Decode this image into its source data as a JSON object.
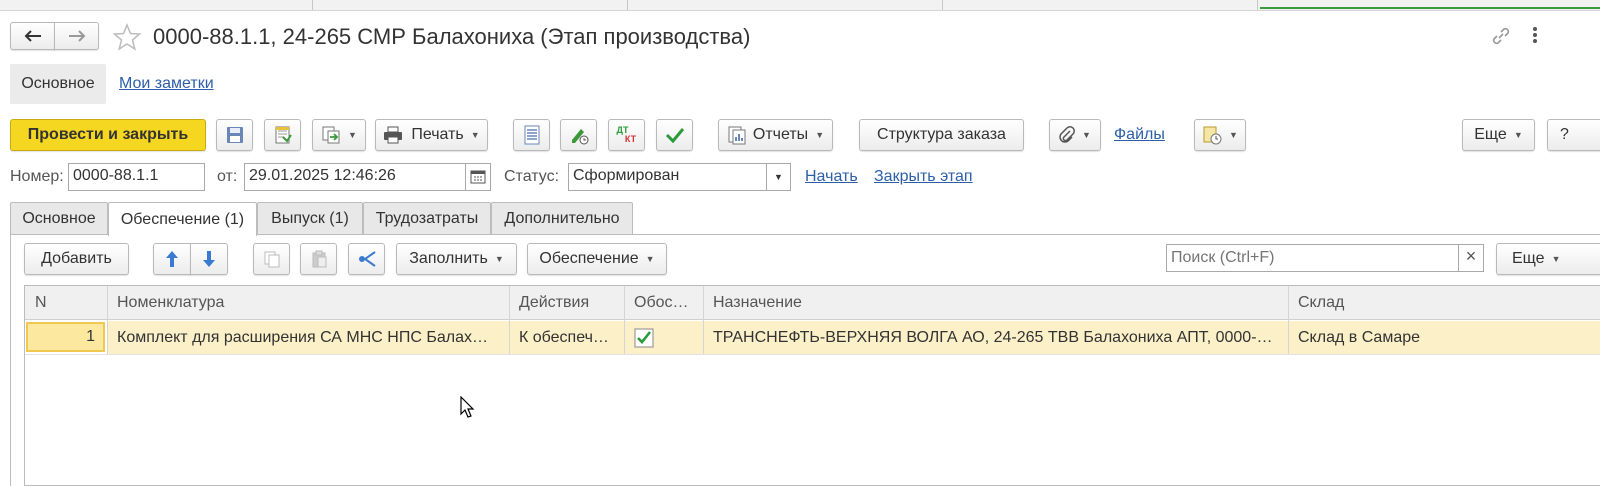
{
  "window": {
    "title": "0000-88.1.1, 24-265 СМР Балахониха (Этап производства)"
  },
  "nav_tabs": [
    {
      "label": "Основное"
    },
    {
      "label": "Мои заметки"
    }
  ],
  "toolbar": {
    "post_close_label": "Провести и закрыть",
    "print_label": "Печать",
    "reports_label": "Отчеты",
    "structure_label": "Структура заказа",
    "files_label": "Файлы",
    "more_label": "Еще",
    "help_label": "?",
    "dtkt_top": "ДТ",
    "dtkt_bottom": "КТ"
  },
  "header_fields": {
    "number_label": "Номер:",
    "number_value": "0000-88.1.1",
    "date_label": "от:",
    "date_value": "29.01.2025 12:46:26",
    "status_label": "Статус:",
    "status_value": "Сформирован",
    "start_link": "Начать",
    "close_stage_link": "Закрыть этап"
  },
  "doc_tabs": [
    {
      "label": "Основное"
    },
    {
      "label": "Обеспечение (1)"
    },
    {
      "label": "Выпуск (1)"
    },
    {
      "label": "Трудозатраты"
    },
    {
      "label": "Дополнительно"
    }
  ],
  "table_toolbar": {
    "add_label": "Добавить",
    "fill_label": "Заполнить",
    "provision_label": "Обеспечение",
    "search_placeholder": "Поиск (Ctrl+F)",
    "clear_glyph": "×",
    "more_label": "Еще"
  },
  "table": {
    "columns": [
      "N",
      "Номенклатура",
      "Действия",
      "Обос…",
      "Назначение",
      "Склад"
    ],
    "rows": [
      {
        "n": "1",
        "nomenclature": "Комплект для расширения СА МНС НПС Балах…",
        "actions": "К обеспеч…",
        "provided": true,
        "purpose": "ТРАНСНЕФТЬ-ВЕРХНЯЯ ВОЛГА АО, 24-265 ТВВ Балахониха АПТ, 0000-…",
        "warehouse": "Склад в Самаре"
      }
    ]
  },
  "colors": {
    "primary_button": "#f5d620",
    "link": "#2d5fa8",
    "selected_row": "#fbf0c8",
    "check": "#2a9a3a"
  }
}
